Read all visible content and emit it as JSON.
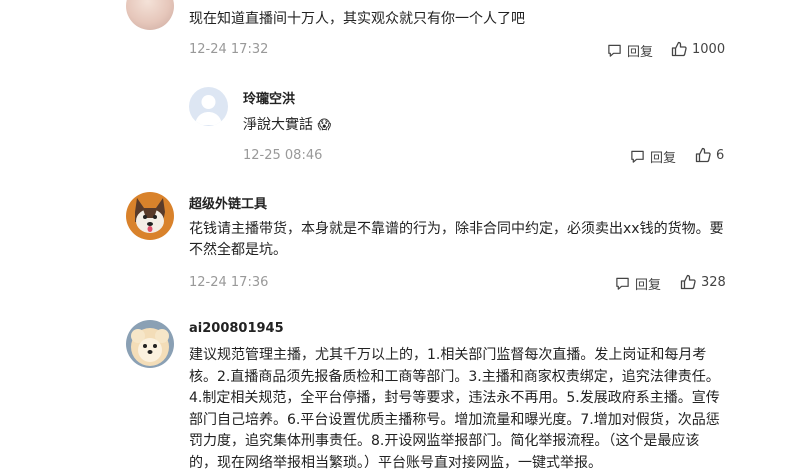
{
  "comments": [
    {
      "content": "现在知道直播间十万人，其实观众就只有你一个人了吧",
      "time": "12-24 17:32",
      "reply_label": "回复",
      "likes": "1000"
    },
    {
      "username": "玲瓏空洪",
      "content": "淨說大實話",
      "emoji": "😱",
      "time": "12-25 08:46",
      "reply_label": "回复",
      "likes": "6"
    },
    {
      "username": "超级外链工具",
      "content_lines": [
        "花钱请主播带货，本身就是不靠谱的行为，除非合同中约定，必须卖出xx钱的货物。要",
        "不然全都是坑。"
      ],
      "time": "12-24 17:36",
      "reply_label": "回复",
      "likes": "328"
    },
    {
      "username": "ai200801945",
      "content_lines": [
        "建议规范管理主播，尤其千万以上的，1.相关部门监督每次直播。发上岗证和每月考",
        "核。2.直播商品须先报备质检和工商等部门。3.主播和商家权责绑定，追究法律责任。",
        "4.制定相关规范，全平台停播，封号等要求，违法永不再用。5.发展政府系主播。宣传",
        "部门自己培养。6.平台设置优质主播称号。增加流量和曝光度。7.增加对假货，次品惩",
        "罚力度，追究集体刑事责任。8.开设网监举报部门。简化举报流程。（这个是最应该",
        "的，现在网络举报相当繁琐。）平台账号直对接网监，一键式举报。"
      ]
    }
  ],
  "colors": {
    "text": "#222222",
    "meta": "#999999",
    "action": "#444444"
  }
}
